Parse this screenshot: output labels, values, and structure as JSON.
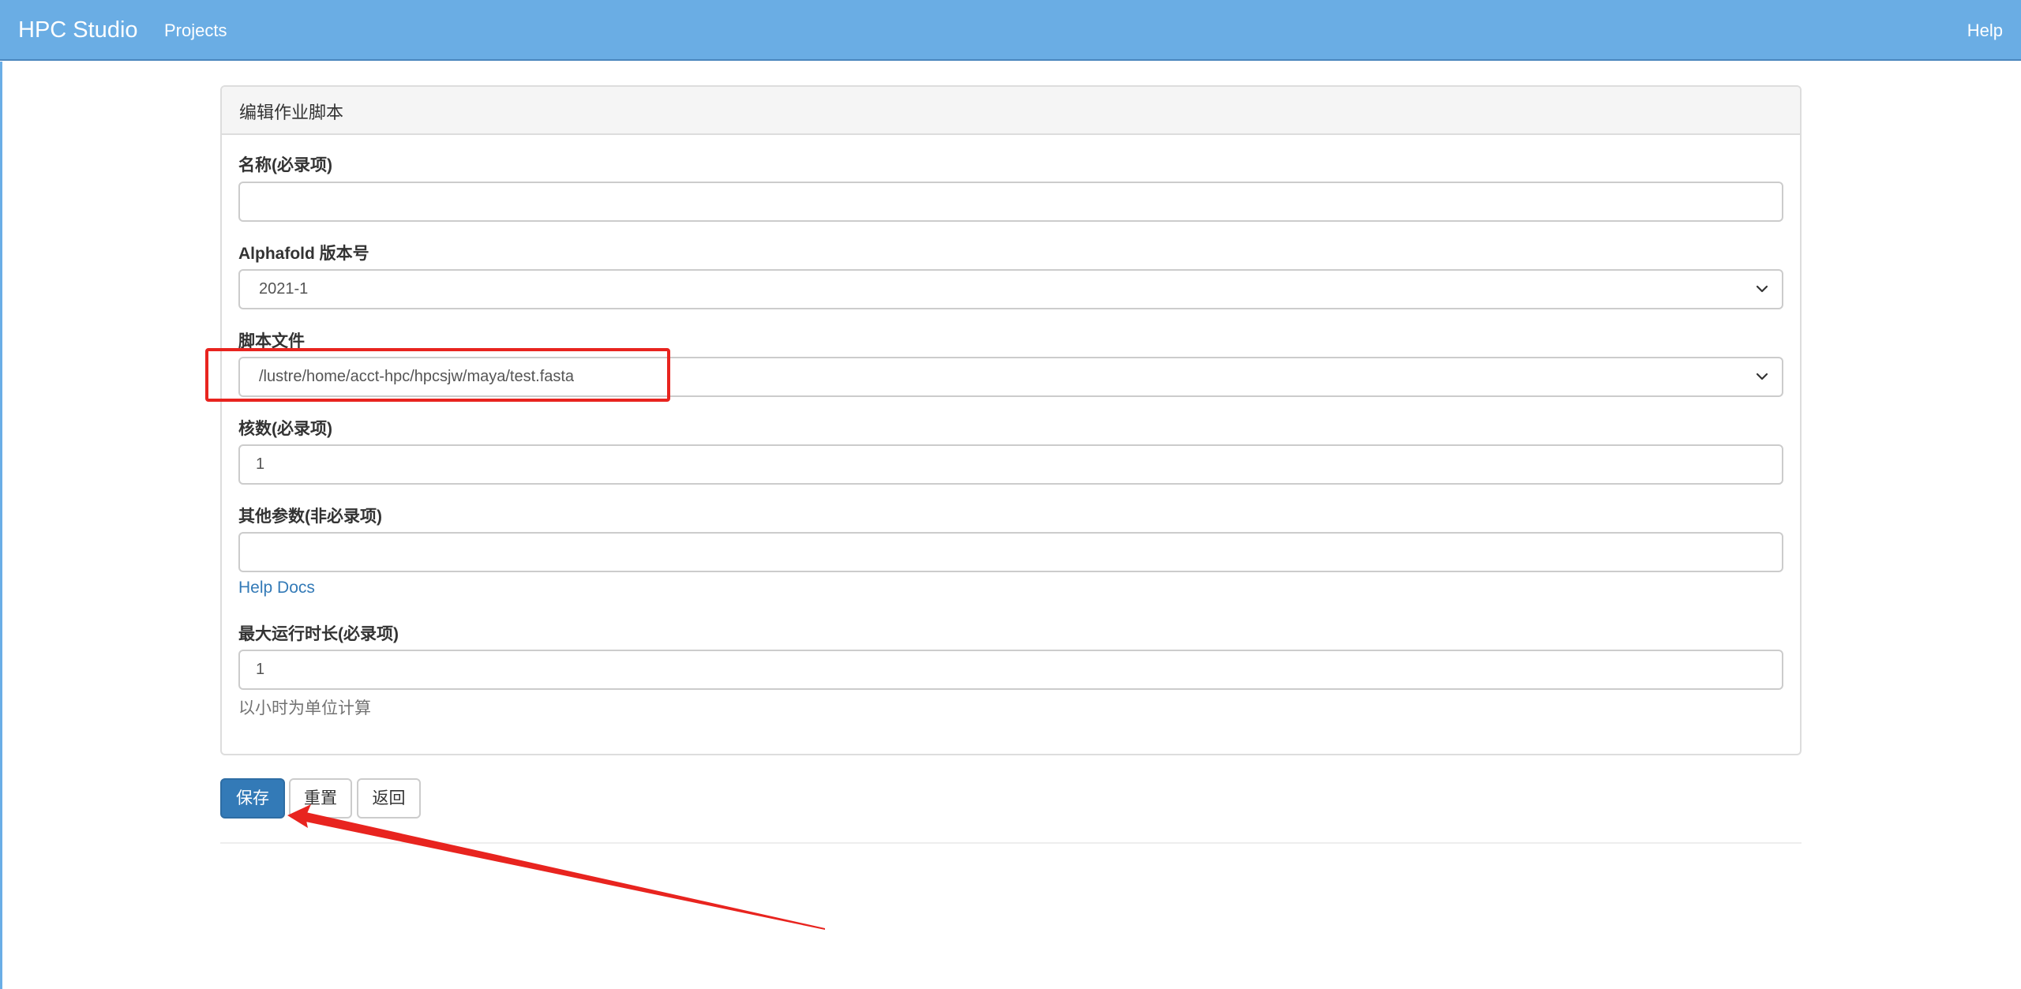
{
  "navbar": {
    "brand": "HPC Studio",
    "projects": "Projects",
    "help": "Help"
  },
  "panel": {
    "title": "编辑作业脚本"
  },
  "form": {
    "name": {
      "label": "名称(必录项)",
      "value": ""
    },
    "version": {
      "label": "Alphafold 版本号",
      "value": "2021-1"
    },
    "script": {
      "label": "脚本文件",
      "value": "/lustre/home/acct-hpc/hpcsjw/maya/test.fasta"
    },
    "cores": {
      "label": "核数(必录项)",
      "value": "1"
    },
    "other": {
      "label": "其他参数(非必录项)",
      "value": ""
    },
    "help_link": "Help Docs",
    "max_runtime": {
      "label": "最大运行时长(必录项)",
      "value": "1",
      "help": "以小时为单位计算"
    }
  },
  "buttons": {
    "save": "保存",
    "reset": "重置",
    "back": "返回"
  },
  "annotation_color": "#e8241f",
  "icons": {
    "select_arrow": "chevron-down-icon"
  }
}
